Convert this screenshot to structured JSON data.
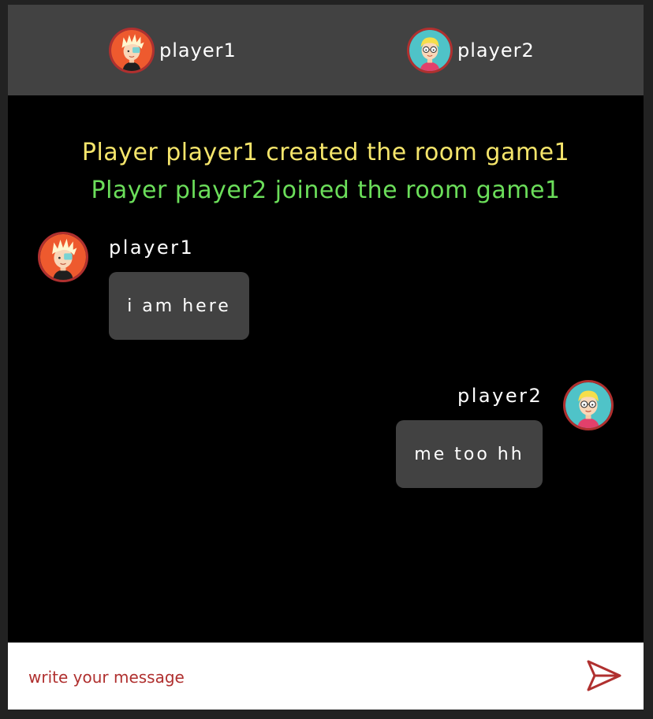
{
  "header": {
    "players": [
      {
        "name": "player1",
        "avatar": "spiky-hair-boy-avatar-icon"
      },
      {
        "name": "player2",
        "avatar": "glasses-boy-avatar-icon"
      }
    ]
  },
  "system_messages": [
    {
      "text": "Player player1 created the room game1",
      "color": "#f5e56b"
    },
    {
      "text": "Player player2 joined the room game1",
      "color": "#6bde5a"
    }
  ],
  "messages": [
    {
      "sender": "player1",
      "text": "i am here",
      "side": "left"
    },
    {
      "sender": "player2",
      "text": "me too hh",
      "side": "right"
    }
  ],
  "composer": {
    "placeholder": "write your message",
    "value": "",
    "send_icon": "send-icon"
  },
  "colors": {
    "header_bg": "#424242",
    "chat_bg": "#000000",
    "bubble_bg": "#424242",
    "accent": "#b0302f"
  }
}
